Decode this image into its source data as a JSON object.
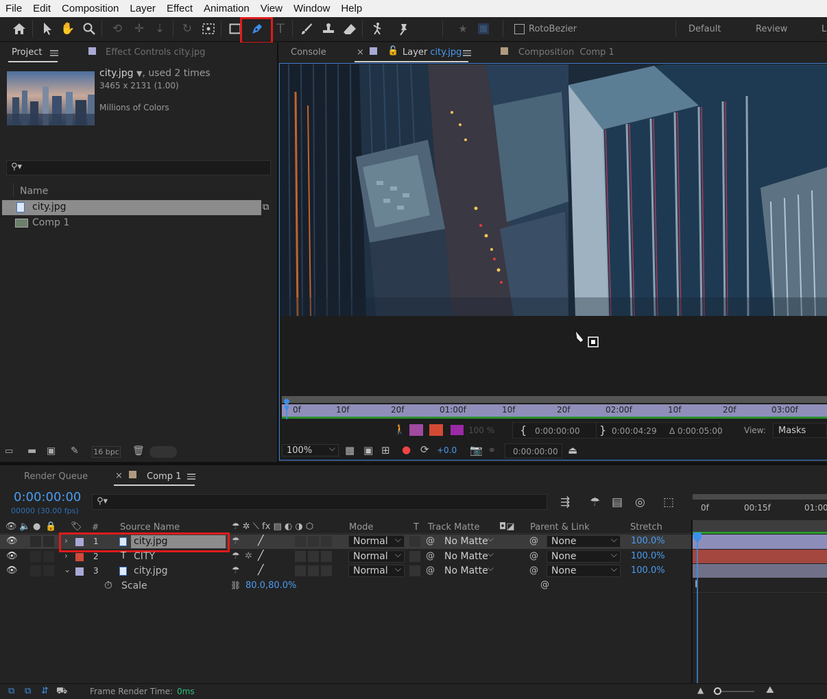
{
  "menu": [
    "File",
    "Edit",
    "Composition",
    "Layer",
    "Effect",
    "Animation",
    "View",
    "Window",
    "Help"
  ],
  "toolbar": {
    "rotobezier_label": "RotoBezier",
    "workspace_default": "Default",
    "workspace_review": "Review",
    "workspace_more": "L",
    "selected_tool": "pen-tool"
  },
  "project_panel": {
    "tab_project": "Project",
    "tab_effect_controls": "Effect Controls",
    "effect_controls_target": "city.jpg",
    "item_name": "city.jpg",
    "used_times": ", used 2 times",
    "dimensions": "3465 x 2131 (1.00)",
    "color_info": "Millions of Colors",
    "search_placeholder": "",
    "column_name": "Name",
    "items": [
      {
        "name": "city.jpg",
        "type": "image",
        "selected": true
      },
      {
        "name": "Comp 1",
        "type": "composition",
        "selected": false
      }
    ],
    "bpc": "16 bpc"
  },
  "viewer": {
    "tab_console": "Console",
    "tab_layer_prefix": "Layer",
    "tab_layer_name": "city.jpg",
    "tab_composition_prefix": "Composition",
    "tab_composition_name": "Comp 1",
    "ruler_labels": [
      "0f",
      "10f",
      "20f",
      "01:00f",
      "10f",
      "20f",
      "02:00f",
      "10f",
      "20f",
      "03:00f"
    ],
    "opacity_value": "100 %",
    "in_time": "0:00:00:00",
    "out_time": "0:00:04:29",
    "duration": "Δ 0:00:05:00",
    "view_label": "View:",
    "view_value": "Masks",
    "zoom": "100%",
    "exposure": "+0.0",
    "current_time": "0:00:00:00"
  },
  "timeline": {
    "tab_render_queue": "Render Queue",
    "tab_comp": "Comp 1",
    "timecode": "0:00:00:00",
    "frame_info": "00000 (30.00 fps)",
    "columns": {
      "num": "#",
      "source_name": "Source Name",
      "mode": "Mode",
      "t": "T",
      "track_matte": "Track Matte",
      "parent_link": "Parent & Link",
      "stretch": "Stretch"
    },
    "layers": [
      {
        "num": "1",
        "name": "city.jpg",
        "type": "image",
        "label_color": "#a9a9d6",
        "mode": "Normal",
        "matte": "No Matte",
        "parent": "None",
        "stretch": "100.0%",
        "selected": true,
        "expanded": false
      },
      {
        "num": "2",
        "name": "CITY",
        "type": "text",
        "label_color": "#d14a3a",
        "mode": "Normal",
        "matte": "No Matte",
        "parent": "None",
        "stretch": "100.0%",
        "selected": false,
        "expanded": false
      },
      {
        "num": "3",
        "name": "city.jpg",
        "type": "image",
        "label_color": "#a9a9d6",
        "mode": "Normal",
        "matte": "No Matte",
        "parent": "None",
        "stretch": "100.0%",
        "selected": false,
        "expanded": true
      }
    ],
    "property_scale_label": "Scale",
    "property_scale_value": "80.0,80.0%",
    "time_labels": [
      "0f",
      "00:15f",
      "01:00"
    ],
    "footer_frame_render_label": "Frame Render Time:",
    "footer_frame_render_value": "0ms"
  },
  "colors": {
    "accent_blue": "#4a9bf0",
    "highlight_red": "#e01b1b",
    "layer_lavender": "#a9a9d6",
    "layer_red": "#d14a3a"
  }
}
